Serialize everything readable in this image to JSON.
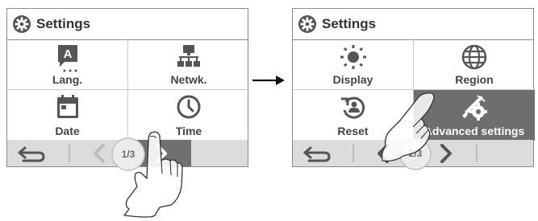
{
  "left_screen": {
    "title": "Settings",
    "items": [
      {
        "label": "Lang.",
        "icon": "language-icon"
      },
      {
        "label": "Netwk.",
        "icon": "network-icon"
      },
      {
        "label": "Date",
        "icon": "calendar-icon"
      },
      {
        "label": "Time",
        "icon": "clock-icon"
      }
    ],
    "page": "1/3"
  },
  "right_screen": {
    "title": "Settings",
    "items": [
      {
        "label": "Display",
        "icon": "brightness-icon"
      },
      {
        "label": "Region",
        "icon": "globe-icon"
      },
      {
        "label": "Reset",
        "icon": "reset-icon"
      },
      {
        "label": "Advanced settings",
        "icon": "tools-icon"
      }
    ],
    "page": "2/3"
  },
  "colors": {
    "frame": "#8a8a8a",
    "icon": "#555555",
    "bottom_bar": "#dcdcdc",
    "selected": "#6e6e6e"
  }
}
